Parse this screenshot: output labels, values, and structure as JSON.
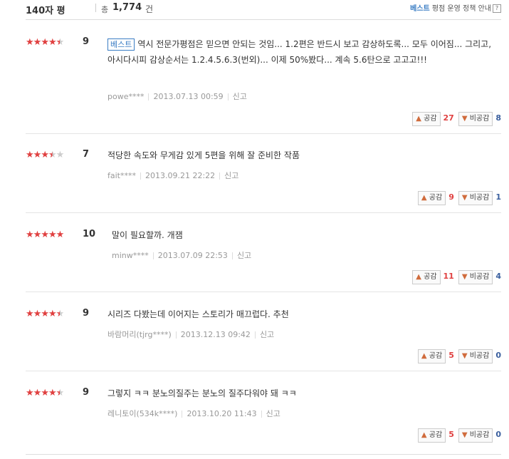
{
  "header": {
    "title": "140자 평",
    "total_label": "총",
    "total_count": "1,774",
    "total_unit": "건",
    "policy_best": "베스트",
    "policy_rest": " 평점 운영 정책 안내",
    "help": "?"
  },
  "vote_labels": {
    "up": "공감",
    "down": "비공감"
  },
  "reviews": [
    {
      "stars": 4.5,
      "score": "9",
      "badge": "베스트",
      "text": "역시 전문가평점은 믿으면 안되는 것임... 1.2편은 반드시 보고 감상하도록... 모두 이어짐... 그리고, 아시다시피 감상순서는 1.2.4.5.6.3(번외)... 이제 50%봤다... 계속 5.6탄으로 고고고!!!",
      "user": "powe****",
      "date": "2013.07.13 00:59",
      "report": "신고",
      "up": "27",
      "down": "8"
    },
    {
      "stars": 3.5,
      "score": "7",
      "badge": "",
      "text": "적당한 속도와 무게감 있게 5편을 위해 잘 준비한 작품",
      "user": "fait****",
      "date": "2013.09.21 22:22",
      "report": "신고",
      "up": "9",
      "down": "1"
    },
    {
      "stars": 5,
      "score": "10",
      "badge": "",
      "text": "말이 필요할까. 개잼",
      "user": "minw****",
      "date": "2013.07.09 22:53",
      "report": "신고",
      "up": "11",
      "down": "4"
    },
    {
      "stars": 4.5,
      "score": "9",
      "badge": "",
      "text": "시리즈 다봤는데 이어지는 스토리가 매끄럽다. 추천",
      "user": "바람머리(tjrg****)",
      "date": "2013.12.13 09:42",
      "report": "신고",
      "up": "5",
      "down": "0"
    },
    {
      "stars": 4.5,
      "score": "9",
      "badge": "",
      "text": "그렇지 ㅋㅋ 분노의질주는 분노의 질주다워야 돼 ㅋㅋ",
      "user": "레니토이(534k****)",
      "date": "2013.10.20 11:43",
      "report": "신고",
      "up": "5",
      "down": "0"
    }
  ]
}
